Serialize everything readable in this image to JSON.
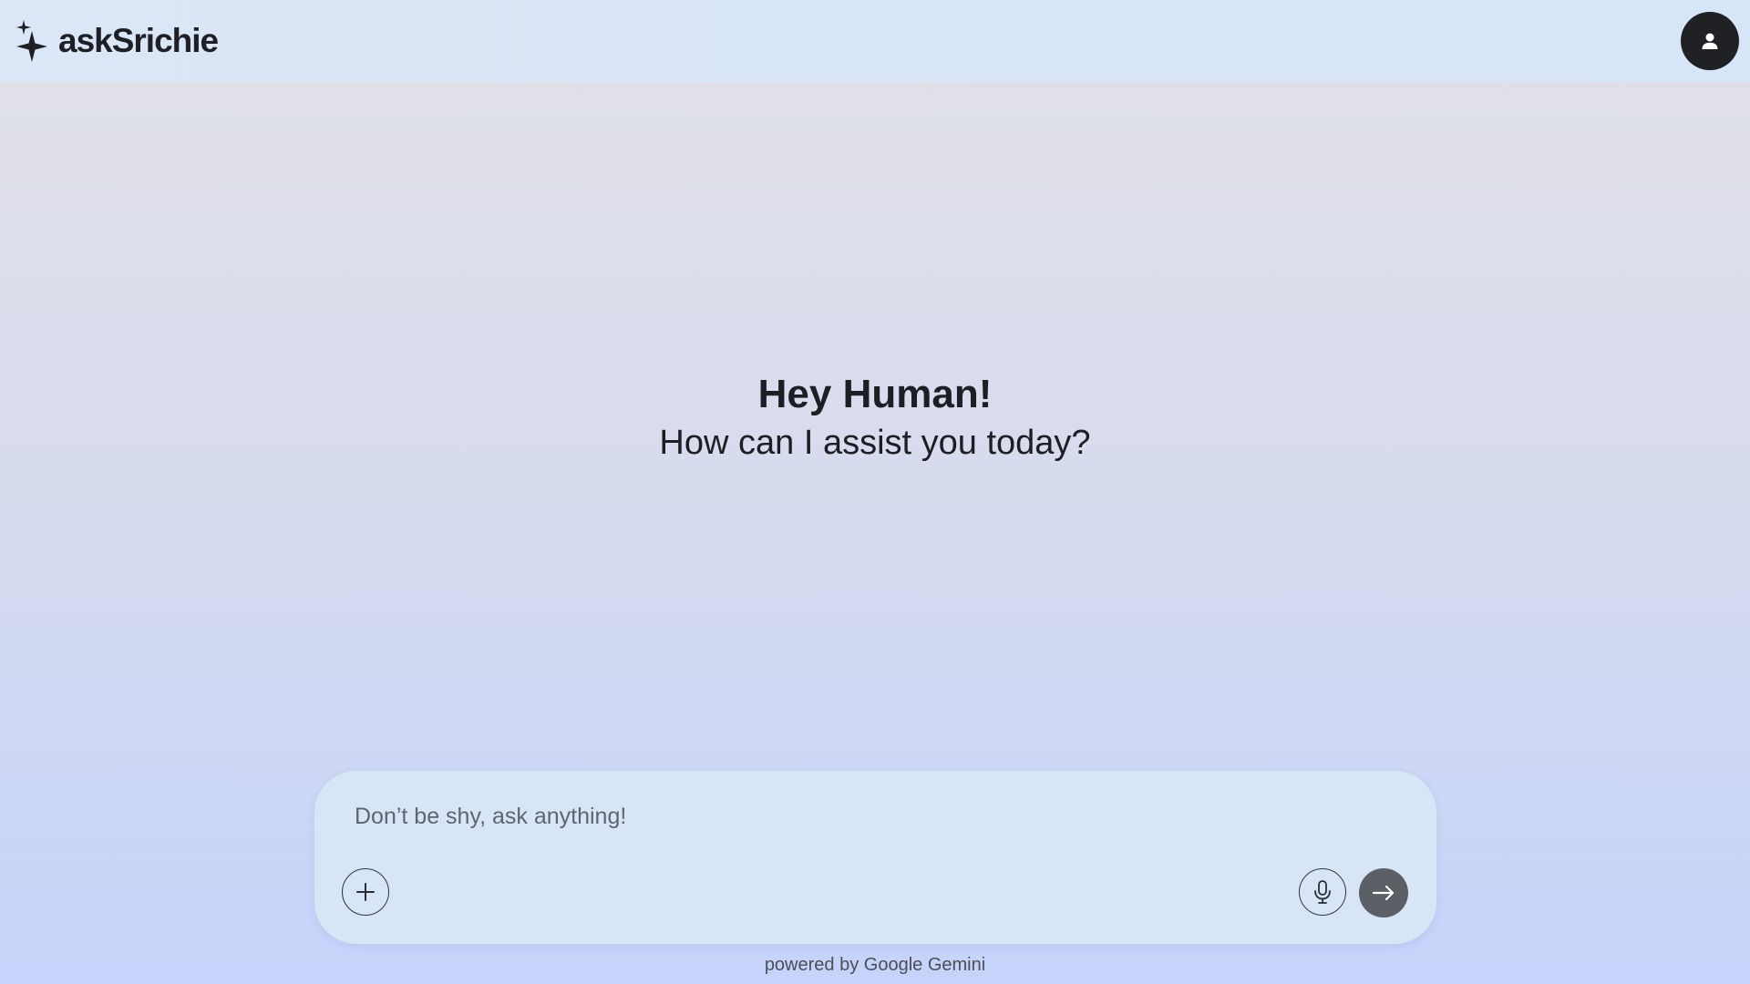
{
  "header": {
    "app_name": "askSrichie",
    "logo_icon": "sparkle-icon",
    "profile_icon": "user-icon"
  },
  "greeting": {
    "title": "Hey Human!",
    "subtitle": "How can I assist you today?"
  },
  "composer": {
    "placeholder": "Don’t be shy, ask anything!",
    "value": "",
    "add_icon": "plus-icon",
    "mic_icon": "microphone-icon",
    "send_icon": "arrow-right-icon"
  },
  "footer": {
    "text": "powered by Google Gemini"
  },
  "colors": {
    "header_bg": "#d7e5f8",
    "page_bg_top": "#e1e1e6",
    "page_bg_bottom": "#c6d3fb",
    "composer_bg": "#d7e5f7",
    "avatar_bg": "#1f2124",
    "send_bg": "#5c5f66",
    "text_primary": "#1e1f24"
  }
}
